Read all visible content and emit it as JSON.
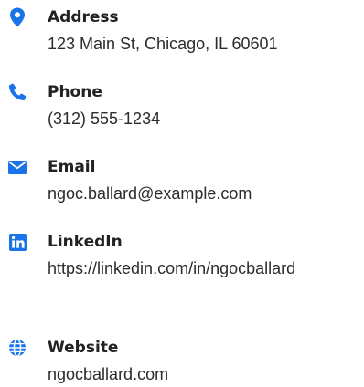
{
  "accent_color": "#1a73e8",
  "contacts": [
    {
      "icon": "location-pin-icon",
      "label": "Address",
      "value": "123 Main St, Chicago, IL 60601"
    },
    {
      "icon": "phone-icon",
      "label": "Phone",
      "value": "(312) 555-1234"
    },
    {
      "icon": "envelope-icon",
      "label": "Email",
      "value": "ngoc.ballard@example.com"
    },
    {
      "icon": "linkedin-icon",
      "label": "LinkedIn",
      "value": "https://linkedin.com/in/ngocballard"
    },
    {
      "icon": "globe-icon",
      "label": "Website",
      "value": "ngocballard.com"
    }
  ]
}
